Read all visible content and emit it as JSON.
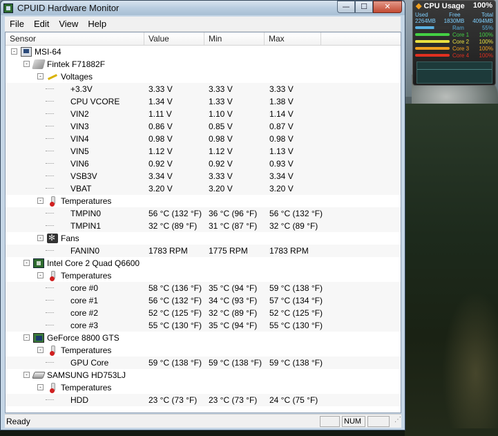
{
  "window": {
    "title": "CPUID Hardware Monitor"
  },
  "menu": [
    "File",
    "Edit",
    "View",
    "Help"
  ],
  "columns": {
    "sensor": "Sensor",
    "value": "Value",
    "min": "Min",
    "max": "Max"
  },
  "tree": [
    {
      "level": 0,
      "icon": "computer-icon",
      "label": "MSI-64",
      "expand": "-"
    },
    {
      "level": 1,
      "icon": "chip-icon",
      "label": "Fintek F71882F",
      "expand": "-"
    },
    {
      "level": 2,
      "icon": "voltage-icon",
      "label": "Voltages",
      "expand": "-"
    },
    {
      "level": 3,
      "label": "+3.3V",
      "value": "3.33 V",
      "min": "3.33 V",
      "max": "3.33 V"
    },
    {
      "level": 3,
      "label": "CPU VCORE",
      "value": "1.34 V",
      "min": "1.33 V",
      "max": "1.38 V"
    },
    {
      "level": 3,
      "label": "VIN2",
      "value": "1.11 V",
      "min": "1.10 V",
      "max": "1.14 V"
    },
    {
      "level": 3,
      "label": "VIN3",
      "value": "0.86 V",
      "min": "0.85 V",
      "max": "0.87 V"
    },
    {
      "level": 3,
      "label": "VIN4",
      "value": "0.98 V",
      "min": "0.98 V",
      "max": "0.98 V"
    },
    {
      "level": 3,
      "label": "VIN5",
      "value": "1.12 V",
      "min": "1.12 V",
      "max": "1.13 V"
    },
    {
      "level": 3,
      "label": "VIN6",
      "value": "0.92 V",
      "min": "0.92 V",
      "max": "0.93 V"
    },
    {
      "level": 3,
      "label": "VSB3V",
      "value": "3.34 V",
      "min": "3.33 V",
      "max": "3.34 V"
    },
    {
      "level": 3,
      "label": "VBAT",
      "value": "3.20 V",
      "min": "3.20 V",
      "max": "3.20 V"
    },
    {
      "level": 2,
      "icon": "thermometer-icon",
      "label": "Temperatures",
      "expand": "-"
    },
    {
      "level": 3,
      "label": "TMPIN0",
      "value": "56 °C  (132 °F)",
      "min": "36 °C  (96 °F)",
      "max": "56 °C  (132 °F)"
    },
    {
      "level": 3,
      "label": "TMPIN1",
      "value": "32 °C  (89 °F)",
      "min": "31 °C  (87 °F)",
      "max": "32 °C  (89 °F)"
    },
    {
      "level": 2,
      "icon": "fan-icon",
      "label": "Fans",
      "expand": "-"
    },
    {
      "level": 3,
      "label": "FANIN0",
      "value": "1783 RPM",
      "min": "1775 RPM",
      "max": "1783 RPM"
    },
    {
      "level": 1,
      "icon": "cpu-icon",
      "label": "Intel Core 2 Quad Q6600",
      "expand": "-"
    },
    {
      "level": 2,
      "icon": "thermometer-icon",
      "label": "Temperatures",
      "expand": "-"
    },
    {
      "level": 3,
      "label": "core #0",
      "value": "58 °C  (136 °F)",
      "min": "35 °C  (94 °F)",
      "max": "59 °C  (138 °F)"
    },
    {
      "level": 3,
      "label": "core #1",
      "value": "56 °C  (132 °F)",
      "min": "34 °C  (93 °F)",
      "max": "57 °C  (134 °F)"
    },
    {
      "level": 3,
      "label": "core #2",
      "value": "52 °C  (125 °F)",
      "min": "32 °C  (89 °F)",
      "max": "52 °C  (125 °F)"
    },
    {
      "level": 3,
      "label": "core #3",
      "value": "55 °C  (130 °F)",
      "min": "35 °C  (94 °F)",
      "max": "55 °C  (130 °F)"
    },
    {
      "level": 1,
      "icon": "gpu-icon",
      "label": "GeForce 8800 GTS",
      "expand": "-"
    },
    {
      "level": 2,
      "icon": "thermometer-icon",
      "label": "Temperatures",
      "expand": "-"
    },
    {
      "level": 3,
      "label": "GPU Core",
      "value": "59 °C  (138 °F)",
      "min": "59 °C  (138 °F)",
      "max": "59 °C  (138 °F)"
    },
    {
      "level": 1,
      "icon": "hdd-icon",
      "label": "SAMSUNG HD753LJ",
      "expand": "-"
    },
    {
      "level": 2,
      "icon": "thermometer-icon",
      "label": "Temperatures",
      "expand": "-"
    },
    {
      "level": 3,
      "label": "HDD",
      "value": "23 °C  (73 °F)",
      "min": "23 °C  (73 °F)",
      "max": "24 °C  (75 °F)"
    }
  ],
  "status": {
    "text": "Ready",
    "num": "NUM"
  },
  "gadget": {
    "title": "CPU Usage",
    "percent": "100%",
    "mem_headers": [
      "Used",
      "Free",
      "Total"
    ],
    "mem_values": [
      "2264MB",
      "1830MB",
      "4094MB"
    ],
    "rows": [
      {
        "label": "Ram",
        "pct": "55%",
        "color": "#5ab0e0",
        "fill": 0.55
      },
      {
        "label": "Core 1",
        "pct": "100%",
        "color": "#44d044",
        "fill": 1.0
      },
      {
        "label": "Core 2",
        "pct": "100%",
        "color": "#e8e040",
        "fill": 1.0
      },
      {
        "label": "Core 3",
        "pct": "100%",
        "color": "#f0a020",
        "fill": 1.0
      },
      {
        "label": "Core 4",
        "pct": "100%",
        "color": "#e03020",
        "fill": 1.0
      }
    ]
  }
}
